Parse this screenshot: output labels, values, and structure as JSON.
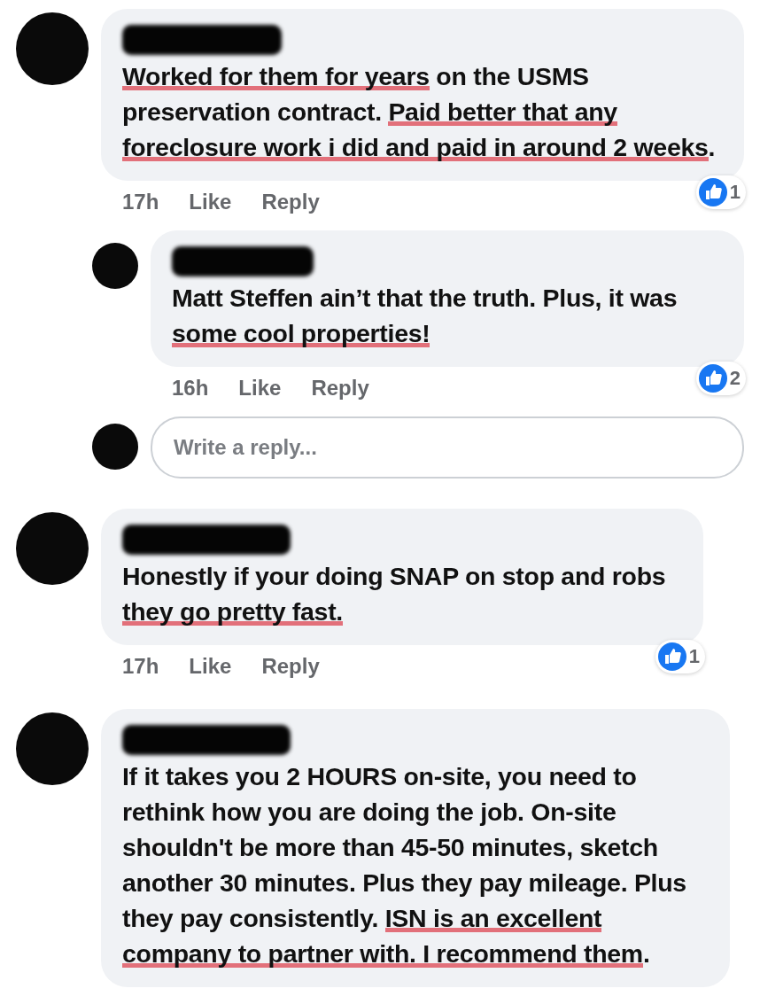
{
  "comments": [
    {
      "segments": [
        {
          "text": "Worked for them for years",
          "marked": true
        },
        {
          "text": " on the USMS preservation contract.   ",
          "marked": false
        },
        {
          "text": "Paid better that any foreclosure work i did and paid in around 2 weeks",
          "marked": true
        },
        {
          "text": ".",
          "marked": false
        }
      ],
      "time": "17h",
      "like": "Like",
      "reply": "Reply",
      "reactions": "1",
      "replies": [
        {
          "segments": [
            {
              "text": "**Matt Steffen** ain’t that the truth. Plus, it was ",
              "marked": false
            },
            {
              "text": "some cool properties!",
              "marked": true
            }
          ],
          "time": "16h",
          "like": "Like",
          "reply": "Reply",
          "reactions": "2"
        }
      ],
      "reply_field": {
        "placeholder": "Write a reply..."
      }
    },
    {
      "segments": [
        {
          "text": "Honestly if your doing SNAP on stop and robs ",
          "marked": false
        },
        {
          "text": "they go pretty fast.",
          "marked": true
        }
      ],
      "time": "17h",
      "like": "Like",
      "reply": "Reply",
      "reactions": "1"
    },
    {
      "segments": [
        {
          "text": "If it takes you 2 HOURS on-site, you need to rethink how you are doing the job. On-site shouldn't be more than 45-50 minutes, sketch another 30 minutes. Plus they pay mileage. Plus they pay consistently. ",
          "marked": false
        },
        {
          "text": "ISN is an excellent company to partner with. I recommend them",
          "marked": true
        },
        {
          "text": ".",
          "marked": false
        }
      ]
    }
  ]
}
